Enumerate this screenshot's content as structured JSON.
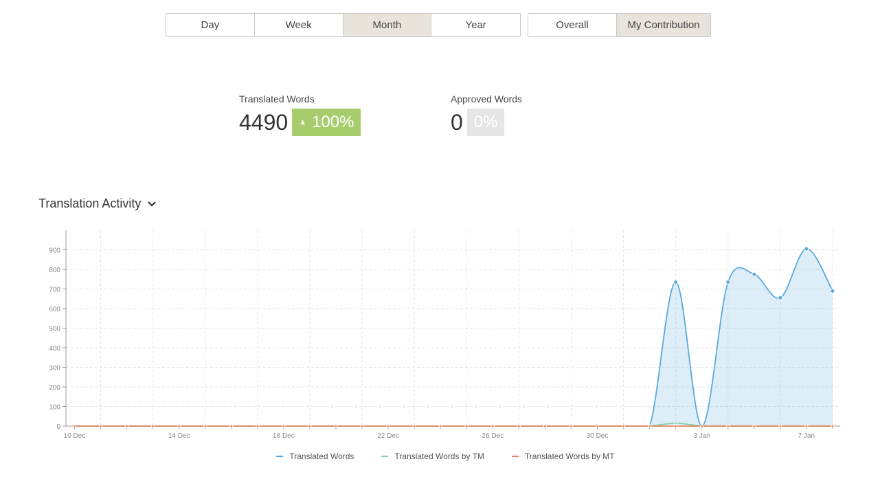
{
  "period_tabs": [
    {
      "label": "Day",
      "active": false
    },
    {
      "label": "Week",
      "active": false
    },
    {
      "label": "Month",
      "active": true
    },
    {
      "label": "Year",
      "active": false
    }
  ],
  "scope_tabs": [
    {
      "label": "Overall",
      "active": false
    },
    {
      "label": "My Contribution",
      "active": true
    }
  ],
  "stats": {
    "translated": {
      "label": "Translated Words",
      "value": "4490",
      "change": "100%",
      "trend": "up"
    },
    "approved": {
      "label": "Approved Words",
      "value": "0",
      "change": "0%",
      "trend": "none"
    }
  },
  "activity": {
    "title": "Translation Activity",
    "toggle_icon": "chevron-down-icon"
  },
  "colors": {
    "translated": "#5aa9dc",
    "tm": "#7fcf9f",
    "mt": "#e8825c",
    "badge_up": "#a6cc6c",
    "badge_flat": "#e6e6e6",
    "active_tab": "#e8e4db"
  },
  "chart_data": {
    "type": "area",
    "title": "",
    "xlabel": "",
    "ylabel": "",
    "ylim": [
      0,
      1000
    ],
    "yticks": [
      0,
      100,
      200,
      300,
      400,
      500,
      600,
      700,
      800,
      900
    ],
    "grid": true,
    "legend_position": "bottom",
    "x": [
      "10 Dec",
      "11 Dec",
      "12 Dec",
      "13 Dec",
      "14 Dec",
      "15 Dec",
      "16 Dec",
      "17 Dec",
      "18 Dec",
      "19 Dec",
      "20 Dec",
      "21 Dec",
      "22 Dec",
      "23 Dec",
      "24 Dec",
      "25 Dec",
      "26 Dec",
      "27 Dec",
      "28 Dec",
      "29 Dec",
      "30 Dec",
      "31 Dec",
      "1 Jan",
      "2 Jan",
      "3 Jan",
      "4 Jan",
      "5 Jan",
      "6 Jan",
      "7 Jan",
      "8 Jan"
    ],
    "x_tick_labels": [
      {
        "index": 0,
        "label": "10 Dec"
      },
      {
        "index": 4,
        "label": "14 Dec"
      },
      {
        "index": 8,
        "label": "18 Dec"
      },
      {
        "index": 12,
        "label": "22 Dec"
      },
      {
        "index": 16,
        "label": "26 Dec"
      },
      {
        "index": 20,
        "label": "30 Dec"
      },
      {
        "index": 24,
        "label": "3 Jan"
      },
      {
        "index": 28,
        "label": "7 Jan"
      }
    ],
    "series": [
      {
        "name": "Translated Words",
        "values": [
          0,
          0,
          0,
          0,
          0,
          0,
          0,
          0,
          0,
          0,
          0,
          0,
          0,
          0,
          0,
          0,
          0,
          0,
          0,
          0,
          0,
          0,
          0,
          735,
          0,
          735,
          775,
          655,
          905,
          690
        ]
      },
      {
        "name": "Translated Words by TM",
        "values": [
          0,
          0,
          0,
          0,
          0,
          0,
          0,
          0,
          0,
          0,
          0,
          0,
          0,
          0,
          0,
          0,
          0,
          0,
          0,
          0,
          0,
          0,
          0,
          15,
          0,
          0,
          0,
          0,
          0,
          0
        ]
      },
      {
        "name": "Translated Words by MT",
        "values": [
          0,
          0,
          0,
          0,
          0,
          0,
          0,
          0,
          0,
          0,
          0,
          0,
          0,
          0,
          0,
          0,
          0,
          0,
          0,
          0,
          0,
          0,
          0,
          0,
          0,
          0,
          0,
          0,
          0,
          0
        ]
      }
    ]
  }
}
